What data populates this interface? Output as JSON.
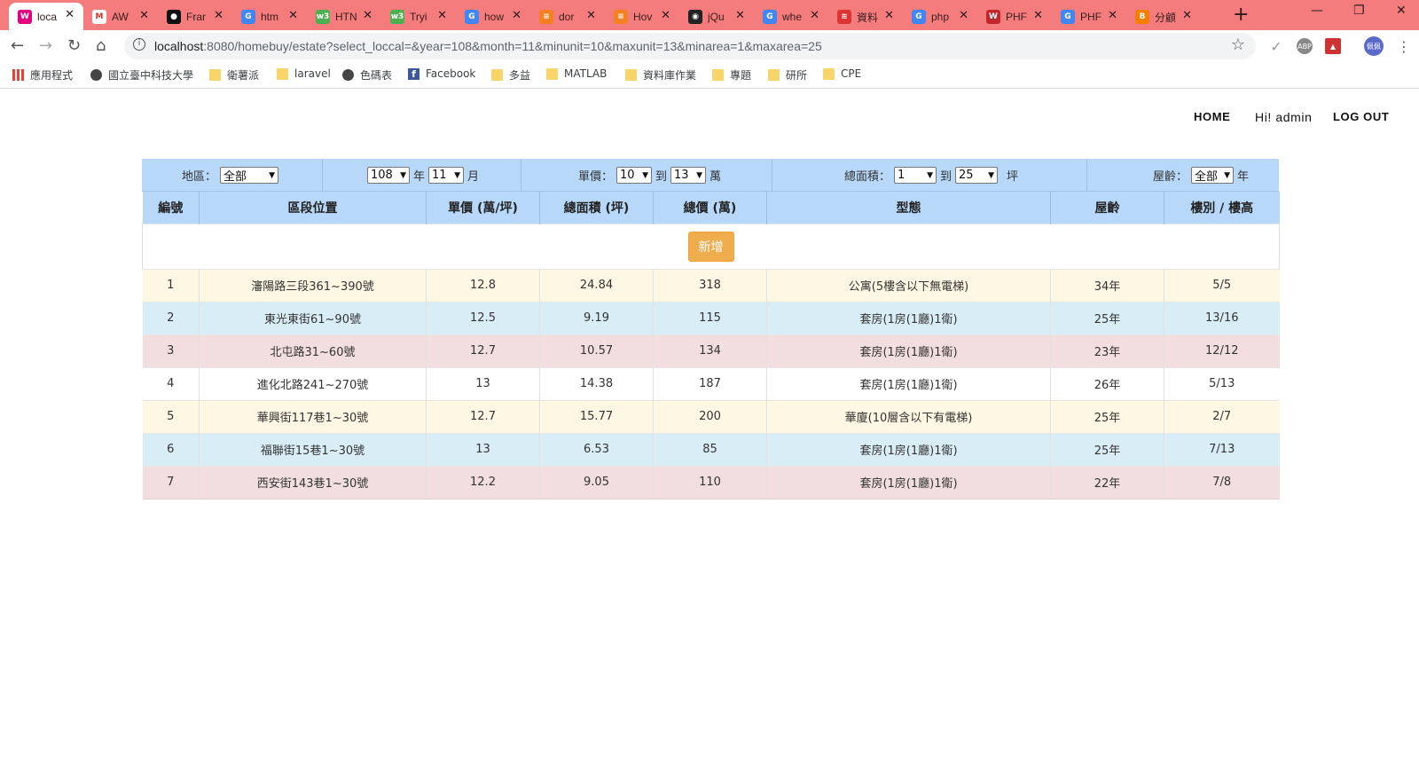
{
  "browser": {
    "tabs": [
      {
        "title": "loca",
        "icon": "wamp-icon",
        "color": "#e4007f",
        "glyph": "W"
      },
      {
        "title": "AW",
        "icon": "gmail-icon",
        "color": "#ffffff",
        "glyph": "M"
      },
      {
        "title": "Frar",
        "icon": "github-icon",
        "color": "#111111",
        "glyph": "●"
      },
      {
        "title": "htm",
        "icon": "google-icon",
        "color": "#4285f4",
        "glyph": "G"
      },
      {
        "title": "HTN",
        "icon": "w3schools-icon",
        "color": "#4caf50",
        "glyph": "w3"
      },
      {
        "title": "Tryi",
        "icon": "w3schools-icon",
        "color": "#4caf50",
        "glyph": "w3"
      },
      {
        "title": "how",
        "icon": "google-icon",
        "color": "#4285f4",
        "glyph": "G"
      },
      {
        "title": "dor",
        "icon": "stackoverflow-icon",
        "color": "#f48024",
        "glyph": "≡"
      },
      {
        "title": "Hov",
        "icon": "stackoverflow-icon",
        "color": "#f48024",
        "glyph": "≡"
      },
      {
        "title": "jQu",
        "icon": "jquery-icon",
        "color": "#222222",
        "glyph": "◉"
      },
      {
        "title": "whe",
        "icon": "google-icon",
        "color": "#4285f4",
        "glyph": "G"
      },
      {
        "title": "資料",
        "icon": "bookmark-icon",
        "color": "#d33",
        "glyph": "≋"
      },
      {
        "title": "php",
        "icon": "google-icon",
        "color": "#4285f4",
        "glyph": "G"
      },
      {
        "title": "PHF",
        "icon": "w-icon",
        "color": "#c0282d",
        "glyph": "W"
      },
      {
        "title": "PHF",
        "icon": "google-icon",
        "color": "#4285f4",
        "glyph": "G"
      },
      {
        "title": "分顧",
        "icon": "blogger-icon",
        "color": "#f57d00",
        "glyph": "B"
      }
    ],
    "url_base": "localhost",
    "url_rest": ":8080/homebuy/estate?select_loccal=&year=108&month=11&minunit=10&maxunit=13&minarea=1&maxarea=25",
    "profile": "佩佩",
    "bookmarks": [
      {
        "label": "應用程式",
        "icon": "grid"
      },
      {
        "label": "國立臺中科技大學",
        "icon": "globe"
      },
      {
        "label": "衛薯派",
        "icon": "folder"
      },
      {
        "label": "laravel",
        "icon": "folder"
      },
      {
        "label": "色碼表",
        "icon": "globe"
      },
      {
        "label": "Facebook",
        "icon": "fb"
      },
      {
        "label": "多益",
        "icon": "folder"
      },
      {
        "label": "MATLAB",
        "icon": "folder"
      },
      {
        "label": "資料庫作業",
        "icon": "folder"
      },
      {
        "label": "專題",
        "icon": "folder"
      },
      {
        "label": "研所",
        "icon": "folder"
      },
      {
        "label": "CPE",
        "icon": "folder"
      }
    ]
  },
  "nav": {
    "home": "HOME",
    "greeting": "Hi! admin",
    "logout": "LOG OUT"
  },
  "filters": {
    "region_label": "地區：",
    "region_value": "全部",
    "year_value": "108",
    "year_unit": "年",
    "month_value": "11",
    "month_unit": "月",
    "unit_price_label": "單價：",
    "unit_min": "10",
    "to1": "到",
    "unit_max": "13",
    "unit_suffix": "萬",
    "area_label": "總面積：",
    "area_min": "1",
    "to2": "到",
    "area_max": "25",
    "area_suffix": "坪",
    "age_label": "屋齡：",
    "age_value": "全部",
    "age_suffix": "年"
  },
  "table": {
    "headers": [
      "編號",
      "區段位置",
      "單價 (萬/坪)",
      "總面積 (坪)",
      "總價 (萬)",
      "型態",
      "屋齡",
      "樓別 / 樓高"
    ],
    "add_label": "新增",
    "rows": [
      [
        "1",
        "瀋陽路三段361~390號",
        "12.8",
        "24.84",
        "318",
        "公寓(5樓含以下無電梯)",
        "34年",
        "5/5"
      ],
      [
        "2",
        "東光東街61~90號",
        "12.5",
        "9.19",
        "115",
        "套房(1房(1廳)1衛)",
        "25年",
        "13/16"
      ],
      [
        "3",
        "北屯路31~60號",
        "12.7",
        "10.57",
        "134",
        "套房(1房(1廳)1衛)",
        "23年",
        "12/12"
      ],
      [
        "4",
        "進化北路241~270號",
        "13",
        "14.38",
        "187",
        "套房(1房(1廳)1衛)",
        "26年",
        "5/13"
      ],
      [
        "5",
        "華興街117巷1~30號",
        "12.7",
        "15.77",
        "200",
        "華廈(10層含以下有電梯)",
        "25年",
        "2/7"
      ],
      [
        "6",
        "福聯街15巷1~30號",
        "13",
        "6.53",
        "85",
        "套房(1房(1廳)1衛)",
        "25年",
        "7/13"
      ],
      [
        "7",
        "西安街143巷1~30號",
        "12.2",
        "9.05",
        "110",
        "套房(1房(1廳)1衛)",
        "22年",
        "7/8"
      ]
    ]
  }
}
